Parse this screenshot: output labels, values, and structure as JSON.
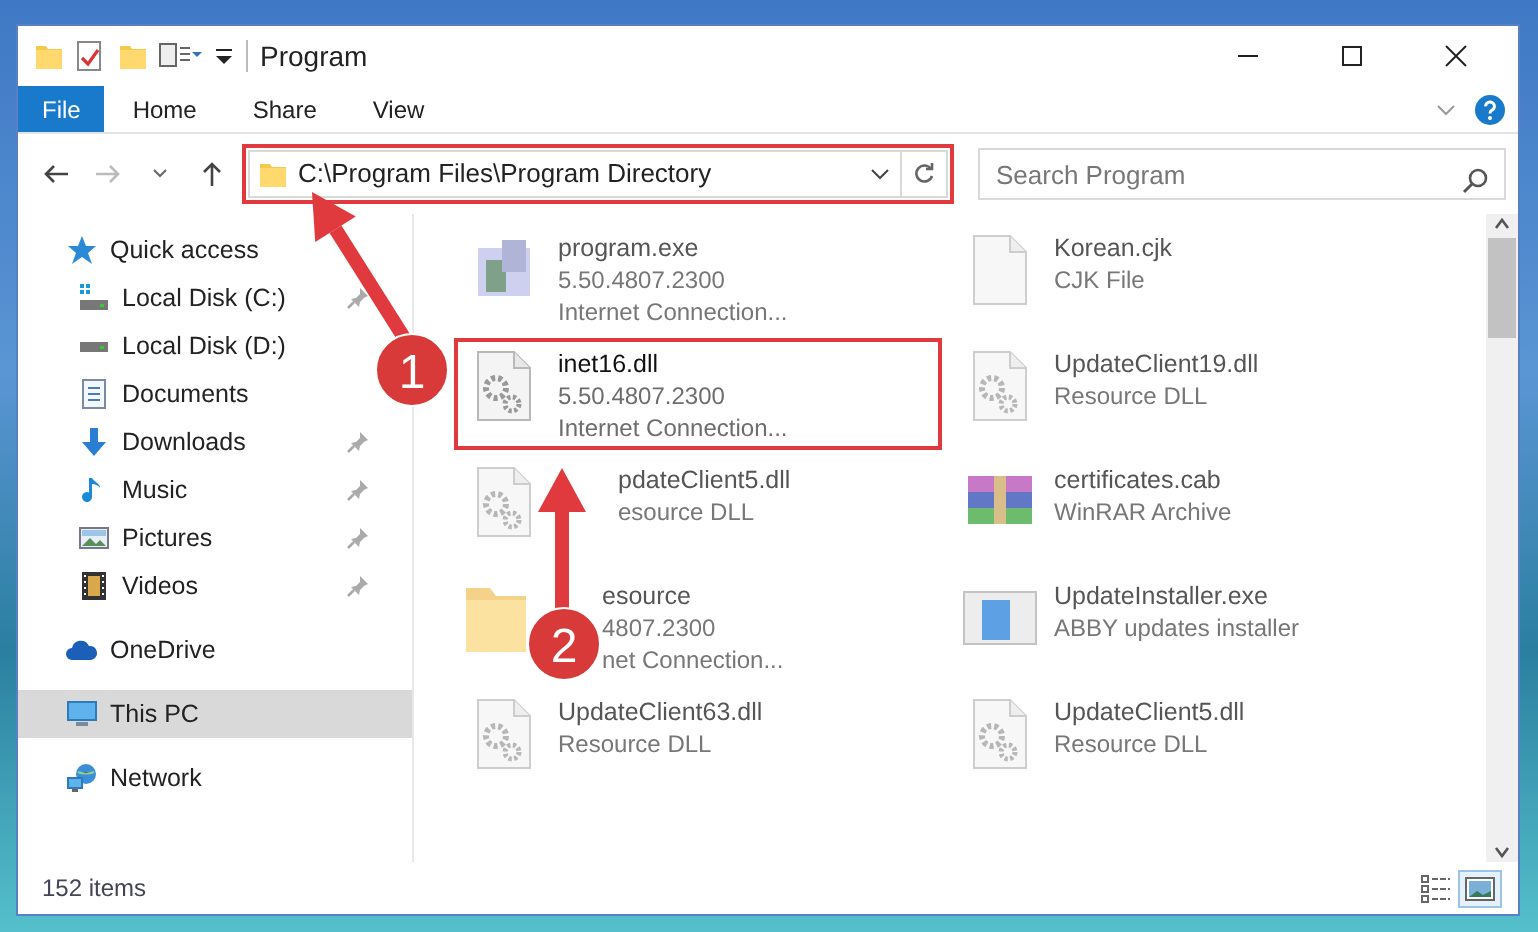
{
  "title_bar": {
    "title": "Program"
  },
  "ribbon": {
    "tabs": [
      {
        "label": "File",
        "kind": "file"
      },
      {
        "label": "Home",
        "kind": "tab"
      },
      {
        "label": "Share",
        "kind": "tab"
      },
      {
        "label": "View",
        "kind": "tab"
      }
    ]
  },
  "address_bar": {
    "path": "C:\\Program Files\\Program Directory",
    "highlighted": true
  },
  "search": {
    "placeholder": "Search Program"
  },
  "sidebar": {
    "items": [
      {
        "label": "Quick access",
        "kind": "star",
        "selected": false,
        "children": [
          {
            "label": "Local Disk (C:)",
            "kind": "disk-c",
            "pinned": true,
            "selected": false
          },
          {
            "label": "Local Disk (D:)",
            "kind": "disk",
            "pinned": false,
            "selected": false
          },
          {
            "label": "Documents",
            "kind": "documents",
            "pinned": false,
            "selected": false
          },
          {
            "label": "Downloads",
            "kind": "downloads",
            "pinned": true,
            "selected": false
          },
          {
            "label": "Music",
            "kind": "music",
            "pinned": true,
            "selected": false
          },
          {
            "label": "Pictures",
            "kind": "pictures",
            "pinned": true,
            "selected": false
          },
          {
            "label": "Videos",
            "kind": "videos",
            "pinned": true,
            "selected": false
          }
        ]
      },
      {
        "label": "OneDrive",
        "kind": "cloud",
        "selected": false
      },
      {
        "label": "This PC",
        "kind": "pc",
        "selected": true
      },
      {
        "label": "Network",
        "kind": "network",
        "selected": false
      }
    ]
  },
  "files": [
    {
      "lines": [
        "program.exe",
        "5.50.4807.2300",
        "Internet Connection..."
      ],
      "kind": "exe",
      "blurred": true,
      "highlighted": false,
      "covered": false
    },
    {
      "lines": [
        "Korean.cjk",
        "CJK File"
      ],
      "kind": "blank",
      "blurred": true,
      "highlighted": false,
      "covered": false
    },
    {
      "lines": [
        "inet16.dll",
        "5.50.4807.2300",
        "Internet Connection..."
      ],
      "kind": "dll",
      "blurred": false,
      "highlighted": true,
      "covered": false
    },
    {
      "lines": [
        "UpdateClient19.dll",
        "Resource DLL"
      ],
      "kind": "dll",
      "blurred": true,
      "highlighted": false,
      "covered": false
    },
    {
      "lines": [
        "pdateClient5.dll",
        "esource DLL"
      ],
      "kind": "dll",
      "blurred": true,
      "highlighted": false,
      "covered": true
    },
    {
      "lines": [
        "certificates.cab",
        "WinRAR Archive"
      ],
      "kind": "archive",
      "blurred": true,
      "highlighted": false,
      "covered": false
    },
    {
      "lines": [
        "esource",
        "4807.2300",
        "net Connection..."
      ],
      "kind": "folder",
      "blurred": true,
      "highlighted": false,
      "covered": true
    },
    {
      "lines": [
        "UpdateInstaller.exe",
        "ABBY updates installer"
      ],
      "kind": "installer",
      "blurred": true,
      "highlighted": false,
      "covered": false
    },
    {
      "lines": [
        "UpdateClient63.dll",
        "Resource DLL"
      ],
      "kind": "dll",
      "blurred": true,
      "highlighted": false,
      "covered": false
    },
    {
      "lines": [
        "UpdateClient5.dll",
        "Resource DLL"
      ],
      "kind": "dll",
      "blurred": true,
      "highlighted": false,
      "covered": false
    }
  ],
  "status_bar": {
    "count": "152 items",
    "views": [
      {
        "kind": "details",
        "selected": false
      },
      {
        "kind": "large-icons",
        "selected": true
      }
    ]
  },
  "annotations": [
    {
      "label": "1"
    },
    {
      "label": "2"
    }
  ]
}
